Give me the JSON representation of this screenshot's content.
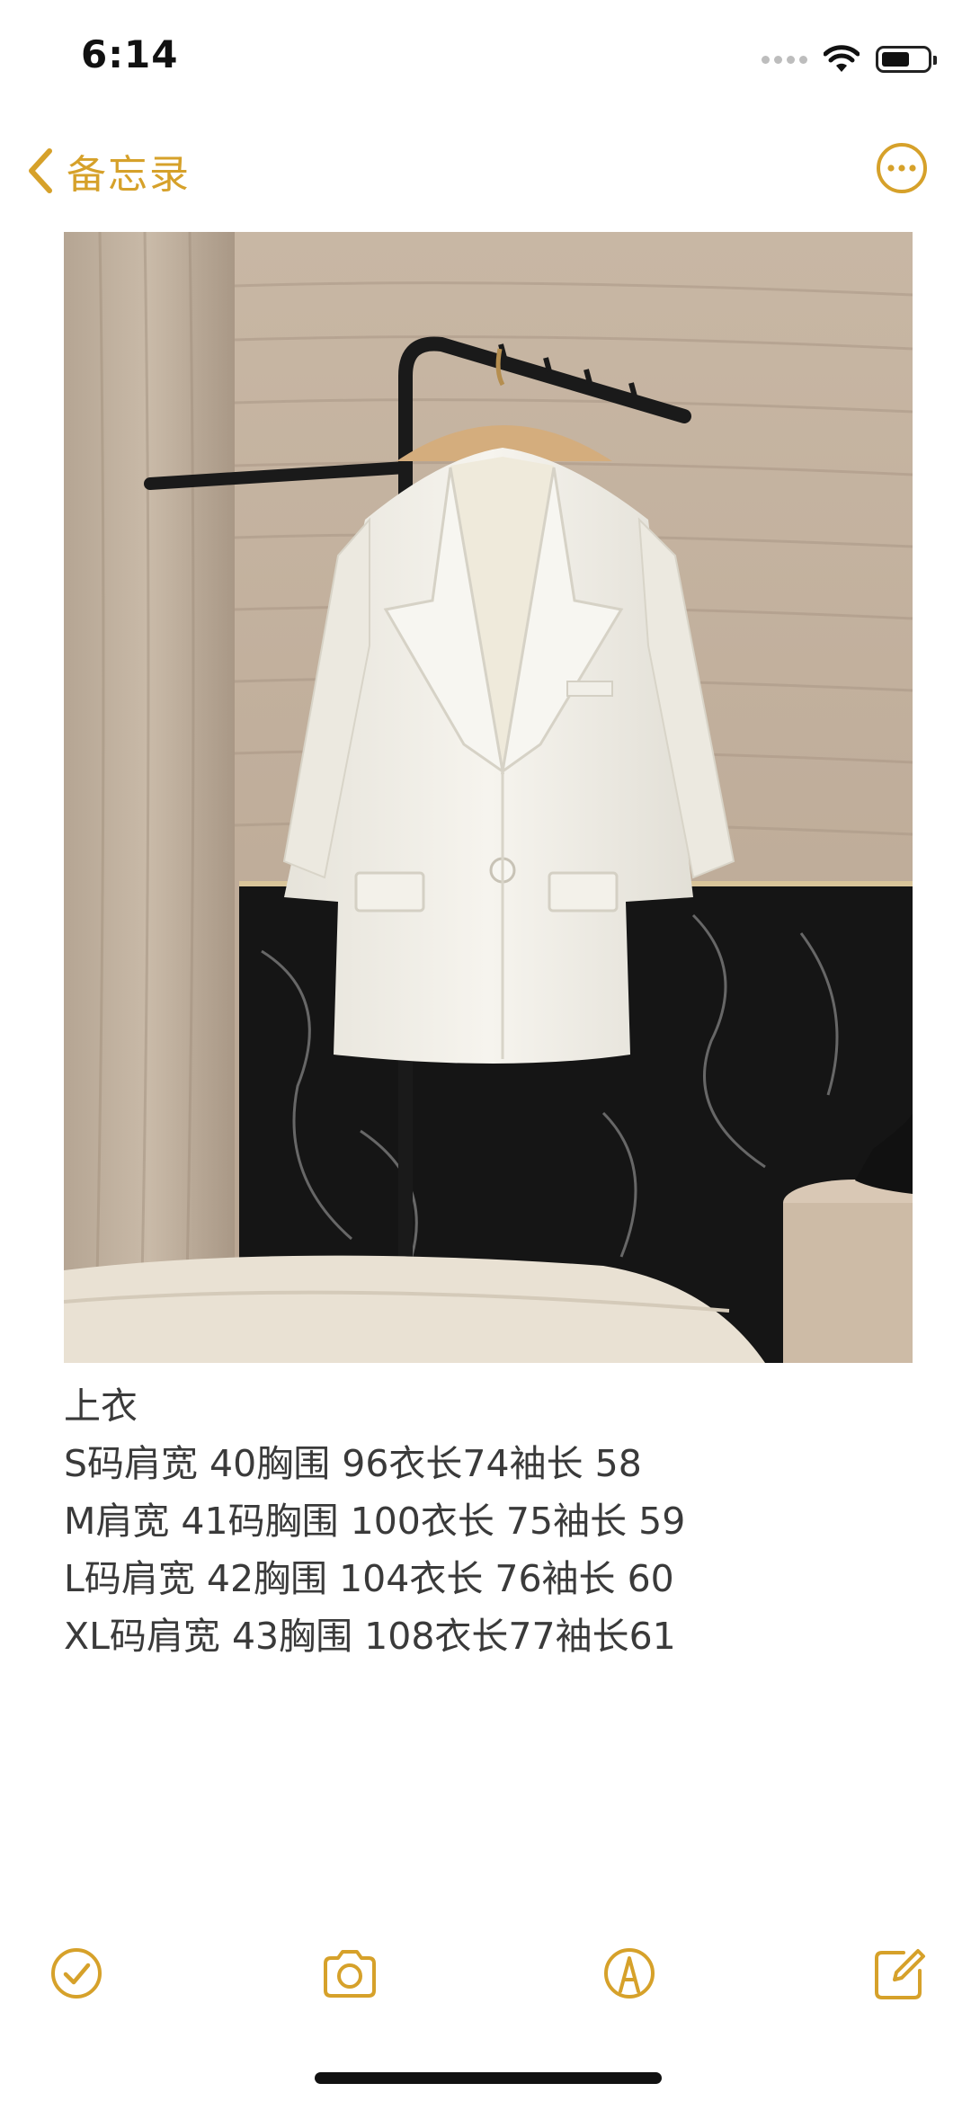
{
  "status_bar": {
    "time": "6:14",
    "icons": [
      "signal-icon",
      "wifi-icon",
      "battery-icon"
    ]
  },
  "nav": {
    "back_label": "备忘录",
    "back_icon": "chevron-left-icon",
    "more_icon": "ellipsis-circle-icon",
    "accent_color": "#D6A12A"
  },
  "photo": {
    "subject": "white blazer on hanger",
    "icons": [
      "photo-image"
    ]
  },
  "note": {
    "lines": [
      "上衣",
      "S码肩宽 40胸围 96衣长74袖长 58",
      "M肩宽 41码胸围 100衣长 75袖长 59",
      "L码肩宽 42胸围 104衣长 76袖长 60",
      "XL码肩宽 43胸围 108衣长77袖长61"
    ]
  },
  "toolbar": {
    "icons": [
      "checklist-icon",
      "camera-icon",
      "markup-icon",
      "compose-icon"
    ]
  }
}
